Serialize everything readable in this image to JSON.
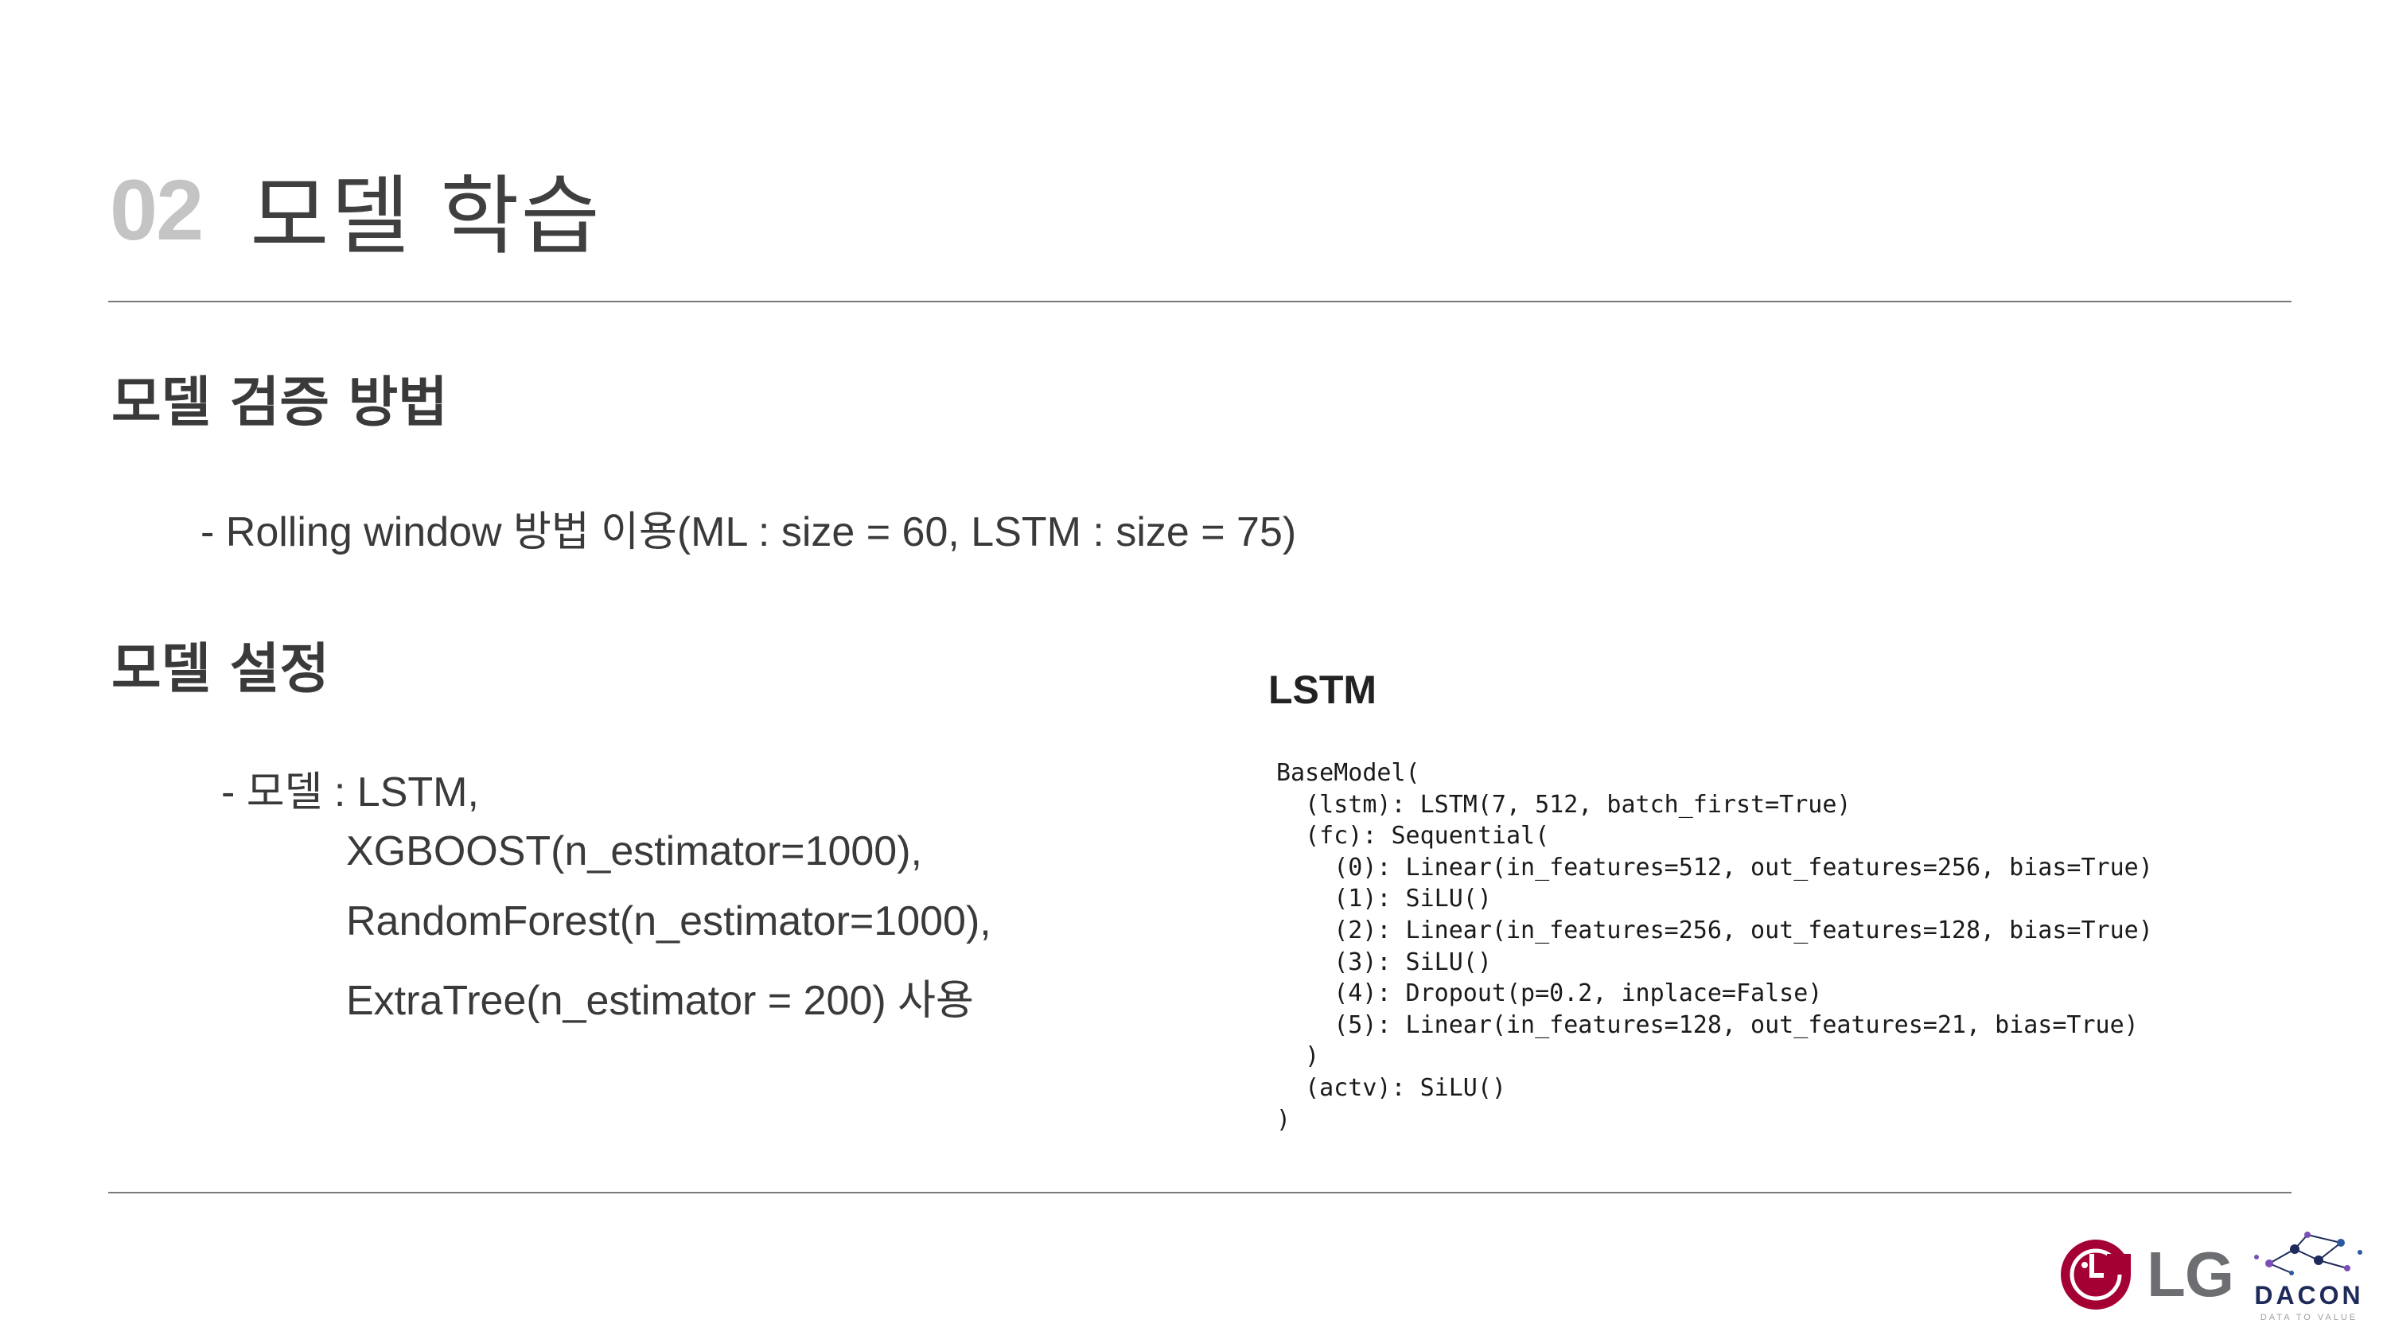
{
  "header": {
    "number": "02",
    "title": "모델 학습"
  },
  "validation": {
    "heading": "모델 검증 방법",
    "line": "- Rolling window 방법 이용(ML : size = 60, LSTM : size = 75)"
  },
  "settings": {
    "heading": "모델 설정",
    "lines": [
      "- 모델 : LSTM,",
      "XGBOOST(n_estimator=1000),",
      "RandomForest(n_estimator=1000),",
      "ExtraTree(n_estimator  = 200) 사용"
    ]
  },
  "lstm": {
    "label": "LSTM",
    "code": [
      "BaseModel(",
      "  (lstm): LSTM(7, 512, batch_first=True)",
      "  (fc): Sequential(",
      "    (0): Linear(in_features=512, out_features=256, bias=True)",
      "    (1): SiLU()",
      "    (2): Linear(in_features=256, out_features=128, bias=True)",
      "    (3): SiLU()",
      "    (4): Dropout(p=0.2, inplace=False)",
      "    (5): Linear(in_features=128, out_features=21, bias=True)",
      "  )",
      "  (actv): SiLU()",
      ")"
    ]
  },
  "logos": {
    "lg": "LG",
    "dacon": "DACON",
    "dacon_tagline": "DATA TO VALUE",
    "lg_color": "#a50034",
    "dacon_color": "#1e2a5a"
  }
}
